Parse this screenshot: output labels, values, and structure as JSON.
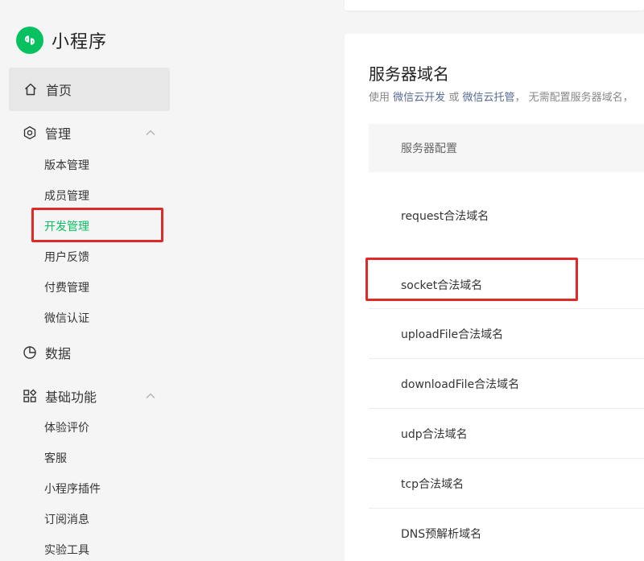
{
  "brand": {
    "title": "小程序",
    "accent": "#07c160"
  },
  "sidebar": {
    "home": {
      "label": "首页",
      "icon": "home-icon"
    },
    "management": {
      "label": "管理",
      "icon": "settings-hexagon-icon",
      "items": [
        "版本管理",
        "成员管理",
        "开发管理",
        "用户反馈",
        "付费管理",
        "微信认证"
      ],
      "active": "开发管理"
    },
    "data": {
      "label": "数据",
      "icon": "pie-chart-icon"
    },
    "basic": {
      "label": "基础功能",
      "icon": "grid-icon",
      "items": [
        "体验评价",
        "客服",
        "小程序插件",
        "订阅消息",
        "实验工具"
      ]
    }
  },
  "main": {
    "title": "服务器域名",
    "desc_prefix": "使用",
    "desc_link1": "微信云开发",
    "desc_mid": "或",
    "desc_link2": "微信云托管",
    "desc_suffix": "， 无需配置服务器域名，",
    "table_header": "服务器配置",
    "rows": [
      "request合法域名",
      "socket合法域名",
      "uploadFile合法域名",
      "downloadFile合法域名",
      "udp合法域名",
      "tcp合法域名",
      "DNS预解析域名"
    ]
  },
  "colors": {
    "highlight": "#e02a2a",
    "link": "#576b95"
  }
}
